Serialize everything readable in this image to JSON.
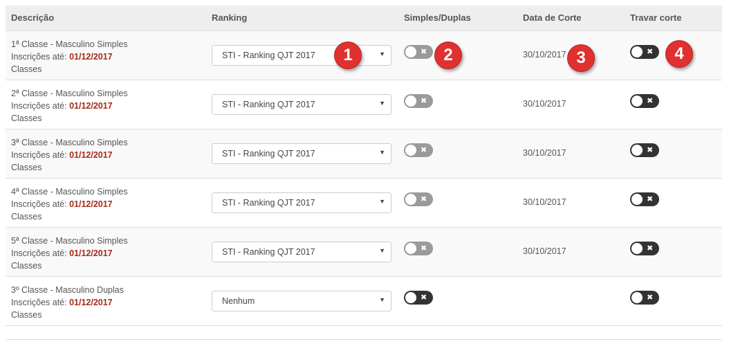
{
  "headers": {
    "descricao": "Descrição",
    "ranking": "Ranking",
    "simples_duplas": "Simples/Duplas",
    "data_corte": "Data de Corte",
    "travar_corte": "Travar corte"
  },
  "rows": [
    {
      "classe": "1ª Classe - Masculino Simples",
      "inscricoes_label": "Inscrições até:",
      "inscricoes_date": "01/12/2017",
      "categoria": "Classes",
      "ranking": "STI - Ranking QJT 2017",
      "data_corte": "30/10/2017",
      "simples_duplas_state": "off",
      "travar_state": "off"
    },
    {
      "classe": "2ª Classe - Masculino Simples",
      "inscricoes_label": "Inscrições até:",
      "inscricoes_date": "01/12/2017",
      "categoria": "Classes",
      "ranking": "STI - Ranking QJT 2017",
      "data_corte": "30/10/2017",
      "simples_duplas_state": "off",
      "travar_state": "off"
    },
    {
      "classe": "3ª Classe - Masculino Simples",
      "inscricoes_label": "Inscrições até:",
      "inscricoes_date": "01/12/2017",
      "categoria": "Classes",
      "ranking": "STI - Ranking QJT 2017",
      "data_corte": "30/10/2017",
      "simples_duplas_state": "off",
      "travar_state": "off"
    },
    {
      "classe": "4ª Classe - Masculino Simples",
      "inscricoes_label": "Inscrições até:",
      "inscricoes_date": "01/12/2017",
      "categoria": "Classes",
      "ranking": "STI - Ranking QJT 2017",
      "data_corte": "30/10/2017",
      "simples_duplas_state": "off",
      "travar_state": "off"
    },
    {
      "classe": "5ª Classe - Masculino Simples",
      "inscricoes_label": "Inscrições até:",
      "inscricoes_date": "01/12/2017",
      "categoria": "Classes",
      "ranking": "STI - Ranking QJT 2017",
      "data_corte": "30/10/2017",
      "simples_duplas_state": "off",
      "travar_state": "off"
    },
    {
      "classe": "3º Classe - Masculino Duplas",
      "inscricoes_label": "Inscrições até:",
      "inscricoes_date": "01/12/2017",
      "categoria": "Classes",
      "ranking": "Nenhum",
      "data_corte": "",
      "simples_duplas_state": "off",
      "travar_state": "off"
    }
  ],
  "toggle_icon": "x-icon",
  "annotations": [
    "1",
    "2",
    "3",
    "4"
  ],
  "colors": {
    "date_accent": "#a52a1b",
    "toggle_grey": "#9a9a9a",
    "toggle_dark": "#333333",
    "badge_red": "#e03131",
    "header_bg": "#eeeeee",
    "stripe_bg": "#f9f9f9"
  }
}
